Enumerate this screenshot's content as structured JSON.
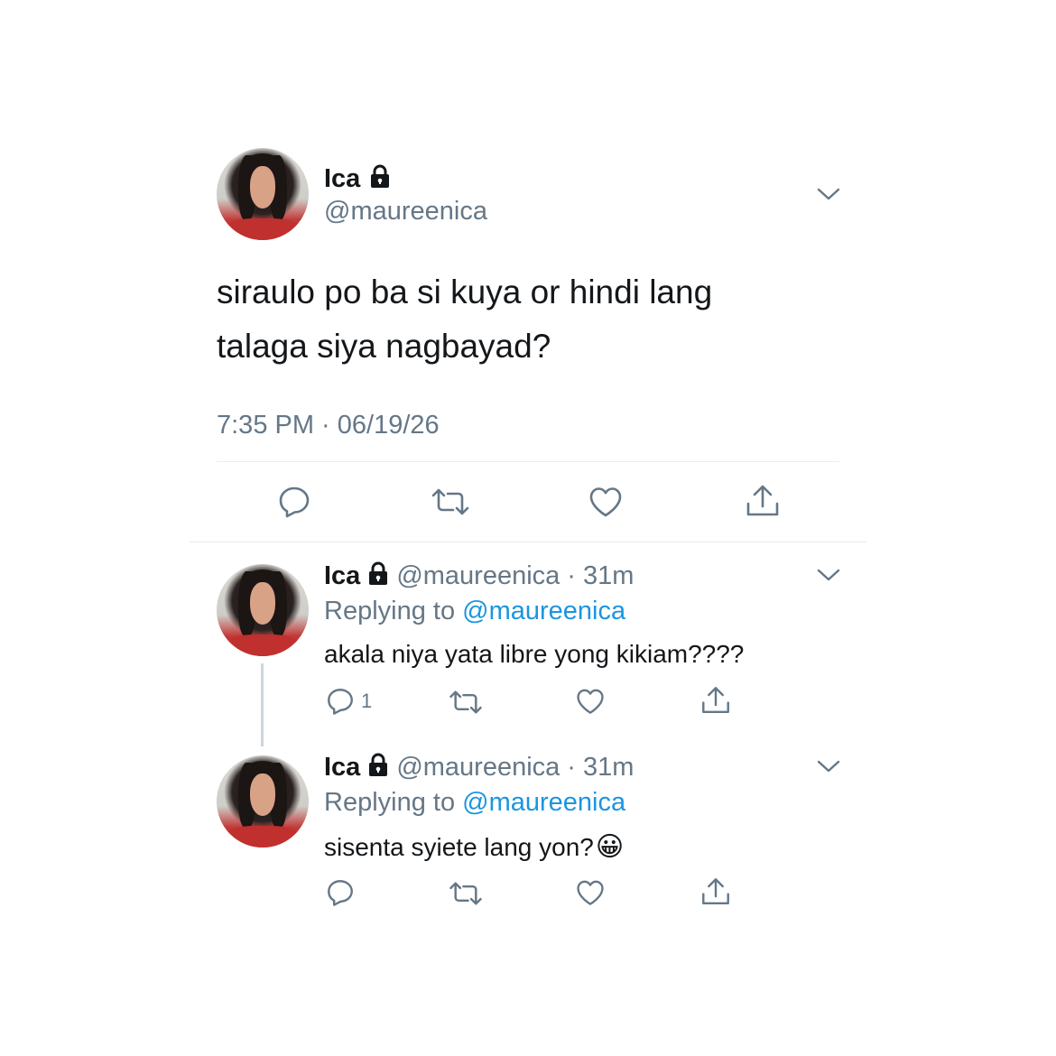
{
  "main_tweet": {
    "name": "Ica",
    "handle": "@maureenica",
    "text_line1": "siraulo po ba si kuya or hindi lang",
    "text_line2": "talaga siya nagbayad?",
    "timestamp": "7:35 PM · 06/19/26"
  },
  "replies": [
    {
      "name": "Ica",
      "handle": "@maureenica",
      "time": "· 31m",
      "replying_prefix": "Replying to",
      "replying_handle": "@maureenica",
      "text": "akala niya yata libre yong kikiam????",
      "reply_count": "1"
    },
    {
      "name": "Ica",
      "handle": "@maureenica",
      "time": "· 31m",
      "replying_prefix": "Replying to",
      "replying_handle": "@maureenica",
      "text": "sisenta syiete lang yon?",
      "emoji": "😀"
    }
  ],
  "icons": [
    "lock-icon",
    "chevron-down-icon",
    "reply-icon",
    "retweet-icon",
    "like-icon",
    "share-icon"
  ],
  "colors": {
    "text": "#14171a",
    "secondary": "#657786",
    "link": "#1b95e0",
    "divider": "#e6ecf0"
  }
}
